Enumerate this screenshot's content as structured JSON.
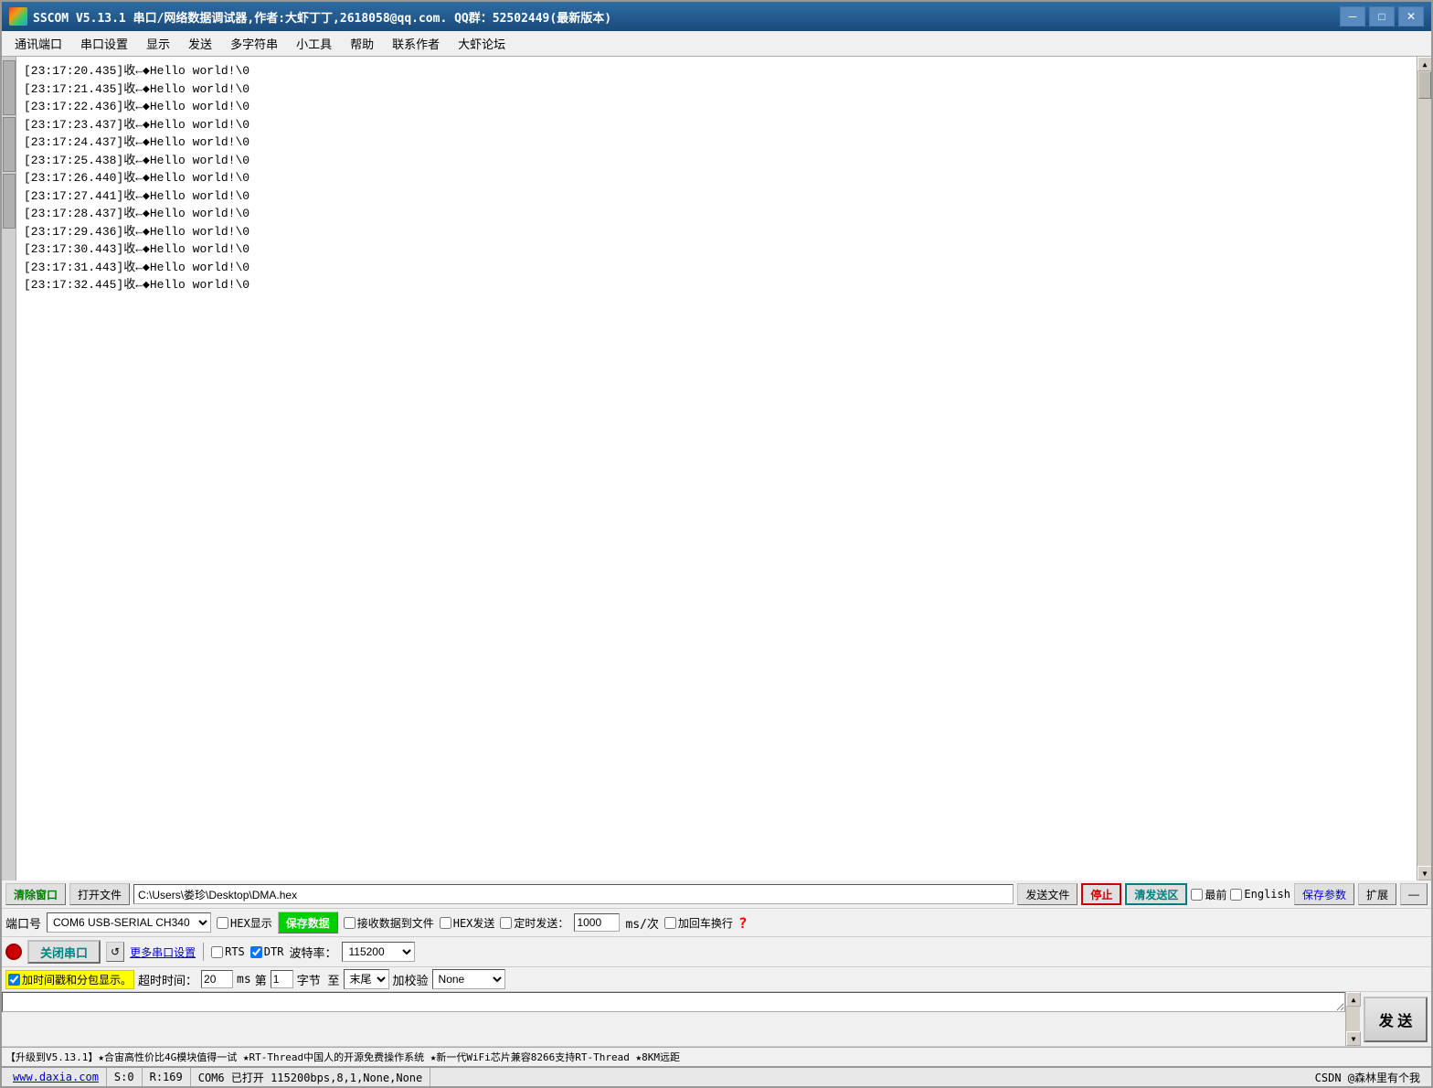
{
  "window": {
    "title": "SSCOM V5.13.1 串口/网络数据调试器,作者:大虾丁丁,2618058@qq.com. QQ群：52502449(最新版本)",
    "icon": "sscom-icon"
  },
  "menu": {
    "items": [
      "通讯端口",
      "串口设置",
      "显示",
      "发送",
      "多字符串",
      "小工具",
      "帮助",
      "联系作者",
      "大虾论坛"
    ]
  },
  "terminal": {
    "lines": [
      "[23:17:20.435]收←◆Hello world!\\0",
      "[23:17:21.435]收←◆Hello world!\\0",
      "[23:17:22.436]收←◆Hello world!\\0",
      "[23:17:23.437]收←◆Hello world!\\0",
      "[23:17:24.437]收←◆Hello world!\\0",
      "[23:17:25.438]收←◆Hello world!\\0",
      "[23:17:26.440]收←◆Hello world!\\0",
      "[23:17:27.441]收←◆Hello world!\\0",
      "[23:17:28.437]收←◆Hello world!\\0",
      "[23:17:29.436]收←◆Hello world!\\0",
      "[23:17:30.443]收←◆Hello world!\\0",
      "[23:17:31.443]收←◆Hello world!\\0",
      "[23:17:32.445]收←◆Hello world!\\0"
    ]
  },
  "toolbar": {
    "clear_btn": "清除窗口",
    "open_file_btn": "打开文件",
    "file_path": "C:\\Users\\娄珍\\Desktop\\DMA.hex",
    "send_file_btn": "发送文件",
    "stop_btn": "停止",
    "clear_send_btn": "清发送区",
    "zuiqian_label": "最前",
    "english_label": "English",
    "save_params_btn": "保存参数",
    "expand_btn": "扩展",
    "collapse_btn": "—"
  },
  "port_settings": {
    "hex_display_label": "HEX显示",
    "save_data_btn": "保存数据",
    "recv_to_file_label": "接收数据到文件",
    "hex_send_label": "HEX发送",
    "timed_send_label": "定时发送：",
    "timed_interval": "1000",
    "timed_unit": "ms/次",
    "add_crlf_label": "加回车换行"
  },
  "connection": {
    "port_label": "端口号",
    "port_value": "COM6  USB-SERIAL CH340",
    "more_settings_btn": "更多串口设置",
    "close_port_btn": "关闭串口",
    "baud_label": "波特率：",
    "baud_value": "115200",
    "rts_label": "RTS",
    "dtr_label": "DTR",
    "question_btn": "?"
  },
  "timestamp": {
    "checkbox_label": "加时间戳和分包显示。",
    "timeout_label": "超时时间：",
    "timeout_value": "20",
    "timeout_unit": "ms",
    "from_label": "第",
    "from_value": "1",
    "byte_label": "字节 至",
    "end_label": "末尾",
    "checksum_label": "加校验",
    "checksum_value": "None"
  },
  "send": {
    "button_label": "发 送",
    "input_value": ""
  },
  "ticker": {
    "text": "【升级到V5.13.1】★合宙高性价比4G模块值得一试 ★RT-Thread中国人的开源免费操作系统 ★新一代WiFi芯片兼容8266支持RT-Thread ★8KM远距"
  },
  "status_bar": {
    "website": "www.daxia.com",
    "s_label": "S:0",
    "r_label": "R:169",
    "port_status": "COM6 已打开  115200bps,8,1,None,None",
    "right_label": "CSDN @森林里有个我"
  }
}
